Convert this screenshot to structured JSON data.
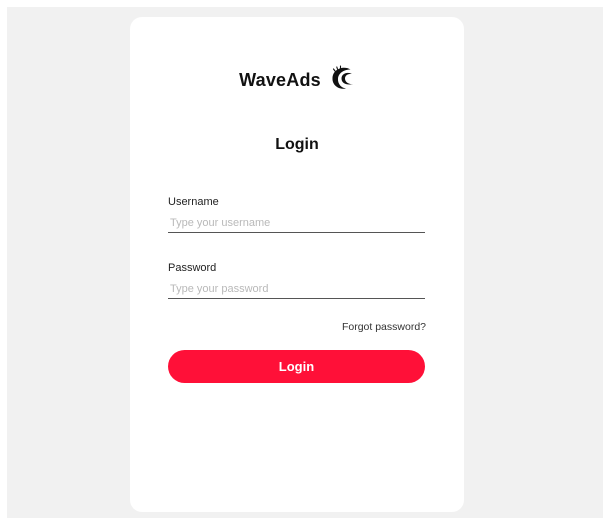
{
  "brand": {
    "name": "WaveAds",
    "icon": "wave-icon"
  },
  "form": {
    "title": "Login",
    "username": {
      "label": "Username",
      "placeholder": "Type your username"
    },
    "password": {
      "label": "Password",
      "placeholder": "Type your password"
    },
    "forgot_label": "Forgot password?",
    "submit_label": "Login"
  },
  "colors": {
    "background": "#f1f1f1",
    "card": "#ffffff",
    "accent": "#ff1038",
    "text": "#111111"
  }
}
